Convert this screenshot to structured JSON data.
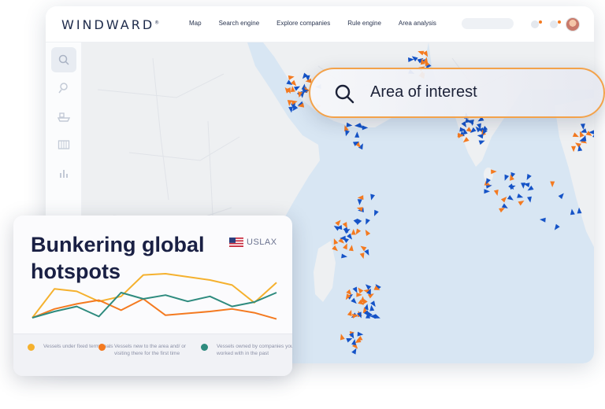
{
  "header": {
    "logo": "WINDWARD",
    "logo_mark": "®",
    "nav": [
      "Map",
      "Search engine",
      "Explore companies",
      "Rule engine",
      "Area analysis"
    ]
  },
  "sidebar": {
    "icons": [
      "search-icon",
      "user-search-icon",
      "vessel-icon",
      "table-icon",
      "bar-chart-icon"
    ]
  },
  "aoi": {
    "label": "Area of interest",
    "icon": "search-icon"
  },
  "card": {
    "title": "Bunkering global hotspots",
    "port": "USLAX",
    "flag": "us-flag-icon",
    "legend": [
      {
        "label": "Vessels under fixed term deals",
        "color": "#f5b12e"
      },
      {
        "label": "Vessels new to the area and/ or visiting there for the first time",
        "color": "#f47a20"
      },
      {
        "label": "Vessels owned by companies you worked with in the past",
        "color": "#2e8b7e"
      }
    ]
  },
  "chart_data": {
    "type": "line",
    "x": [
      0,
      1,
      2,
      3,
      4,
      5,
      6,
      7,
      8,
      9,
      10,
      11
    ],
    "series": [
      {
        "color": "#f5b12e",
        "values": [
          20,
          66,
          62,
          46,
          54,
          88,
          90,
          85,
          80,
          72,
          44,
          76
        ]
      },
      {
        "color": "#f47a20",
        "values": [
          20,
          34,
          42,
          48,
          32,
          50,
          24,
          27,
          30,
          34,
          28,
          18
        ]
      },
      {
        "color": "#2e8b7e",
        "values": [
          20,
          30,
          38,
          22,
          60,
          50,
          56,
          46,
          54,
          38,
          45,
          60
        ]
      }
    ],
    "ylim": [
      0,
      100
    ]
  },
  "map": {
    "colors": {
      "water": "#d8e6f3",
      "land": "#eef0f2",
      "blue": "#1553c7",
      "orange": "#f47a20"
    }
  }
}
